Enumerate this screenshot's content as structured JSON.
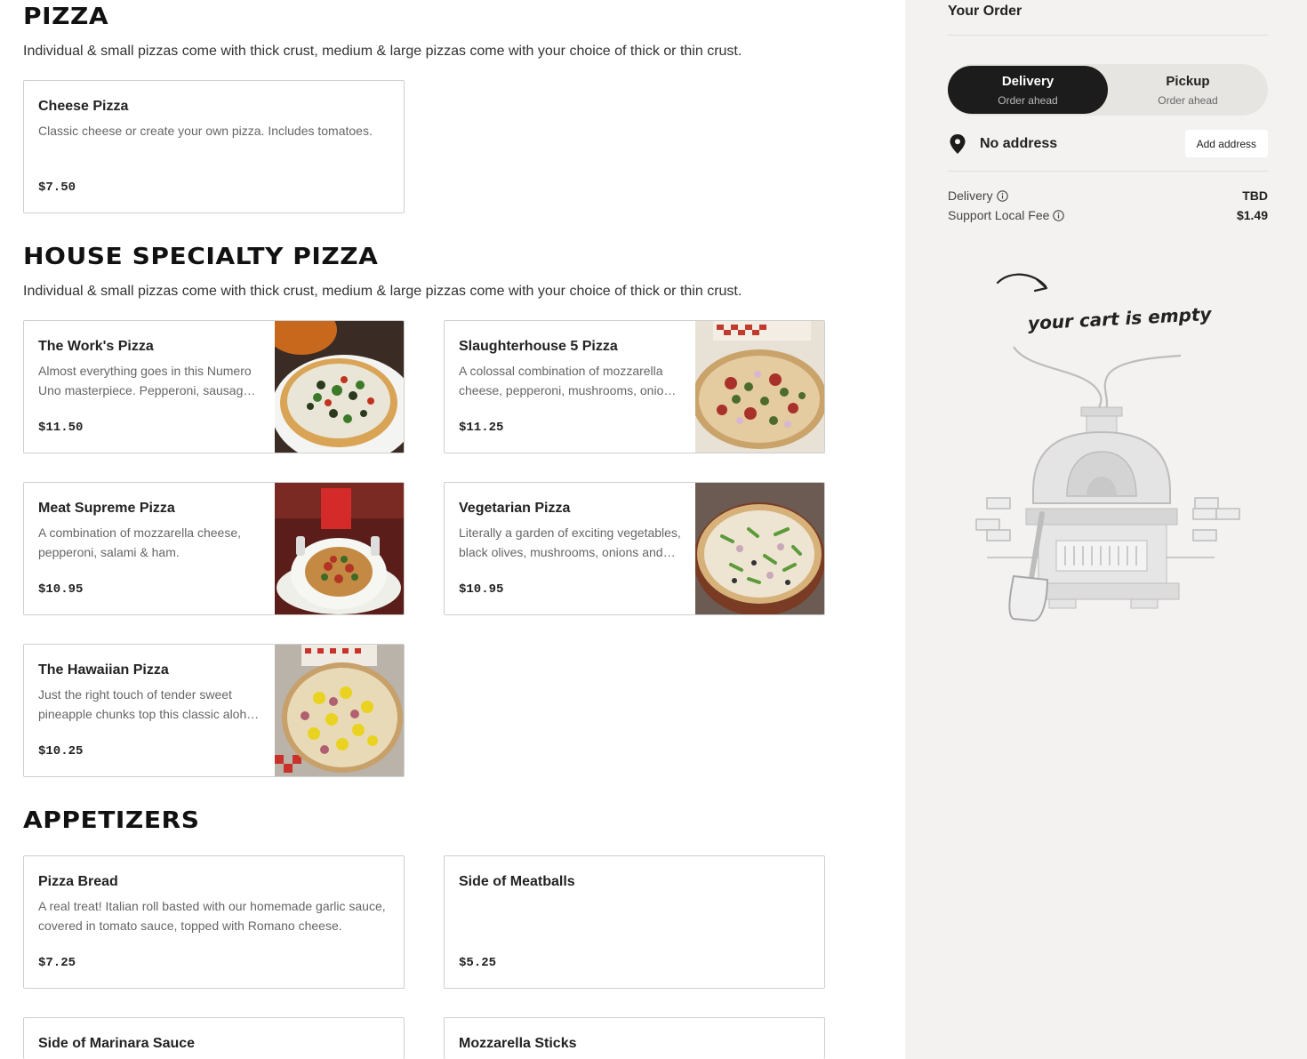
{
  "menu": {
    "sections": [
      {
        "title": "PIZZA",
        "description": "Individual & small pizzas come with thick crust, medium & large pizzas come with your choice of thick or thin crust.",
        "items": [
          {
            "name": "Cheese Pizza",
            "description": "Classic cheese or create your own pizza. Includes tomatoes.",
            "price": "$7.50"
          }
        ]
      },
      {
        "title": "HOUSE SPECIALTY PIZZA",
        "description": "Individual & small pizzas come with thick crust, medium & large pizzas come with your choice of thick or thin crust.",
        "items": [
          {
            "name": "The Work's Pizza",
            "description": "Almost everything goes in this Numero Uno masterpiece. Pepperoni, sausage, mushrooms and more.",
            "price": "$11.50"
          },
          {
            "name": "Slaughterhouse 5 Pizza",
            "description": "A colossal combination of mozzarella cheese, pepperoni, mushrooms, onions and jalapenos.",
            "price": "$11.25"
          },
          {
            "name": "Meat Supreme Pizza",
            "description": "A combination of mozzarella cheese, pepperoni, salami & ham.",
            "price": "$10.95"
          },
          {
            "name": "Vegetarian Pizza",
            "description": "Literally a garden of exciting vegetables, black olives, mushrooms, onions and peppers.",
            "price": "$10.95"
          },
          {
            "name": "The Hawaiian Pizza",
            "description": "Just the right touch of tender sweet pineapple chunks top this classic aloha favorite.",
            "price": "$10.25"
          }
        ]
      },
      {
        "title": "APPETIZERS",
        "items": [
          {
            "name": "Pizza Bread",
            "description": "A real treat! Italian roll basted with our homemade garlic sauce, covered in tomato sauce, topped with Romano cheese.",
            "price": "$7.25"
          },
          {
            "name": "Side of Meatballs",
            "description": "",
            "price": "$5.25"
          },
          {
            "name": "Side of Marinara Sauce"
          },
          {
            "name": "Mozzarella Sticks"
          }
        ]
      }
    ]
  },
  "order": {
    "title": "Your Order",
    "modes": [
      {
        "label": "Delivery",
        "sub": "Order ahead",
        "active": true
      },
      {
        "label": "Pickup",
        "sub": "Order ahead",
        "active": false
      }
    ],
    "address": {
      "text": "No address",
      "button": "Add address"
    },
    "fees": [
      {
        "label": "Delivery",
        "value": "TBD"
      },
      {
        "label": "Support Local Fee",
        "value": "$1.49"
      }
    ],
    "empty_cart_text": "your cart is empty"
  },
  "colors": {
    "dark": "#1c1c1c",
    "sidebar_bg": "#f3f2f0",
    "card_border": "#cfcfcf"
  }
}
